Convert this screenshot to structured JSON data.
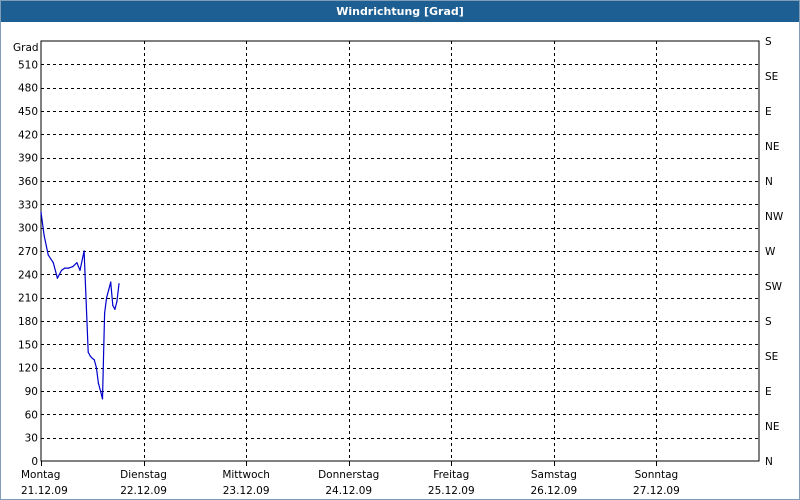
{
  "window": {
    "title": "Windrichtung [Grad]"
  },
  "chart_data": {
    "type": "line",
    "title": "Windrichtung [Grad]",
    "ylabel": "Grad",
    "ylim": [
      0,
      540
    ],
    "y_ticks": [
      0,
      30,
      60,
      90,
      120,
      150,
      180,
      210,
      240,
      270,
      300,
      330,
      360,
      390,
      420,
      450,
      480,
      510
    ],
    "y2_ticks": [
      "N",
      "NE",
      "E",
      "SE",
      "S",
      "SW",
      "W",
      "NW",
      "N",
      "NE",
      "E",
      "SE",
      "S"
    ],
    "x_ticks": [
      {
        "day": "Montag",
        "date": "21.12.09"
      },
      {
        "day": "Dienstag",
        "date": "22.12.09"
      },
      {
        "day": "Mittwoch",
        "date": "23.12.09"
      },
      {
        "day": "Donnerstag",
        "date": "24.12.09"
      },
      {
        "day": "Freitag",
        "date": "25.12.09"
      },
      {
        "day": "Samstag",
        "date": "26.12.09"
      },
      {
        "day": "Sonntag",
        "date": "27.12.09"
      }
    ],
    "xlim": [
      0,
      7
    ],
    "grid": true,
    "line_color": "#0000cc",
    "series": [
      {
        "x": [
          0.0,
          0.03,
          0.07,
          0.12,
          0.16,
          0.2,
          0.23,
          0.27,
          0.31,
          0.35,
          0.38,
          0.42,
          0.46,
          0.48,
          0.5,
          0.52,
          0.54,
          0.56,
          0.58,
          0.6,
          0.62,
          0.64,
          0.66,
          0.68,
          0.7,
          0.72,
          0.74,
          0.76
        ],
        "y": [
          320,
          290,
          265,
          255,
          235,
          245,
          248,
          248,
          250,
          255,
          245,
          270,
          140,
          135,
          132,
          130,
          120,
          100,
          90,
          80,
          190,
          210,
          220,
          230,
          200,
          195,
          205,
          228
        ]
      }
    ]
  }
}
